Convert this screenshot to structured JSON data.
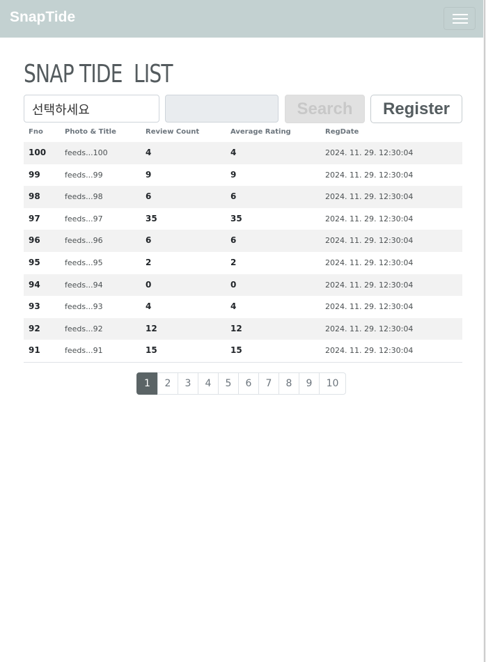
{
  "app": {
    "brand": "SnapTide"
  },
  "header": {
    "title": "SNAP TIDE  LIST"
  },
  "search": {
    "select_value": "선택하세요",
    "input_value": "",
    "search_label": "Search",
    "register_label": "Register"
  },
  "table": {
    "columns": [
      "Fno",
      "Photo & Title",
      "Review Count",
      "Average Rating",
      "RegDate"
    ],
    "rows": [
      {
        "fno": "100",
        "title": "feeds...100",
        "review_count": "4",
        "avg_rating": "4",
        "regdate": "2024. 11. 29. 12:30:04"
      },
      {
        "fno": "99",
        "title": "feeds...99",
        "review_count": "9",
        "avg_rating": "9",
        "regdate": "2024. 11. 29. 12:30:04"
      },
      {
        "fno": "98",
        "title": "feeds...98",
        "review_count": "6",
        "avg_rating": "6",
        "regdate": "2024. 11. 29. 12:30:04"
      },
      {
        "fno": "97",
        "title": "feeds...97",
        "review_count": "35",
        "avg_rating": "35",
        "regdate": "2024. 11. 29. 12:30:04"
      },
      {
        "fno": "96",
        "title": "feeds...96",
        "review_count": "6",
        "avg_rating": "6",
        "regdate": "2024. 11. 29. 12:30:04"
      },
      {
        "fno": "95",
        "title": "feeds...95",
        "review_count": "2",
        "avg_rating": "2",
        "regdate": "2024. 11. 29. 12:30:04"
      },
      {
        "fno": "94",
        "title": "feeds...94",
        "review_count": "0",
        "avg_rating": "0",
        "regdate": "2024. 11. 29. 12:30:04"
      },
      {
        "fno": "93",
        "title": "feeds...93",
        "review_count": "4",
        "avg_rating": "4",
        "regdate": "2024. 11. 29. 12:30:04"
      },
      {
        "fno": "92",
        "title": "feeds...92",
        "review_count": "12",
        "avg_rating": "12",
        "regdate": "2024. 11. 29. 12:30:04"
      },
      {
        "fno": "91",
        "title": "feeds...91",
        "review_count": "15",
        "avg_rating": "15",
        "regdate": "2024. 11. 29. 12:30:04"
      }
    ]
  },
  "pagination": {
    "pages": [
      "1",
      "2",
      "3",
      "4",
      "5",
      "6",
      "7",
      "8",
      "9",
      "10"
    ],
    "active": "1"
  },
  "icons": {
    "menu": "hamburger-menu-icon"
  },
  "colors": {
    "navbar": "#c3d1d1",
    "active_page": "#5b6466",
    "title": "#545b5e"
  }
}
